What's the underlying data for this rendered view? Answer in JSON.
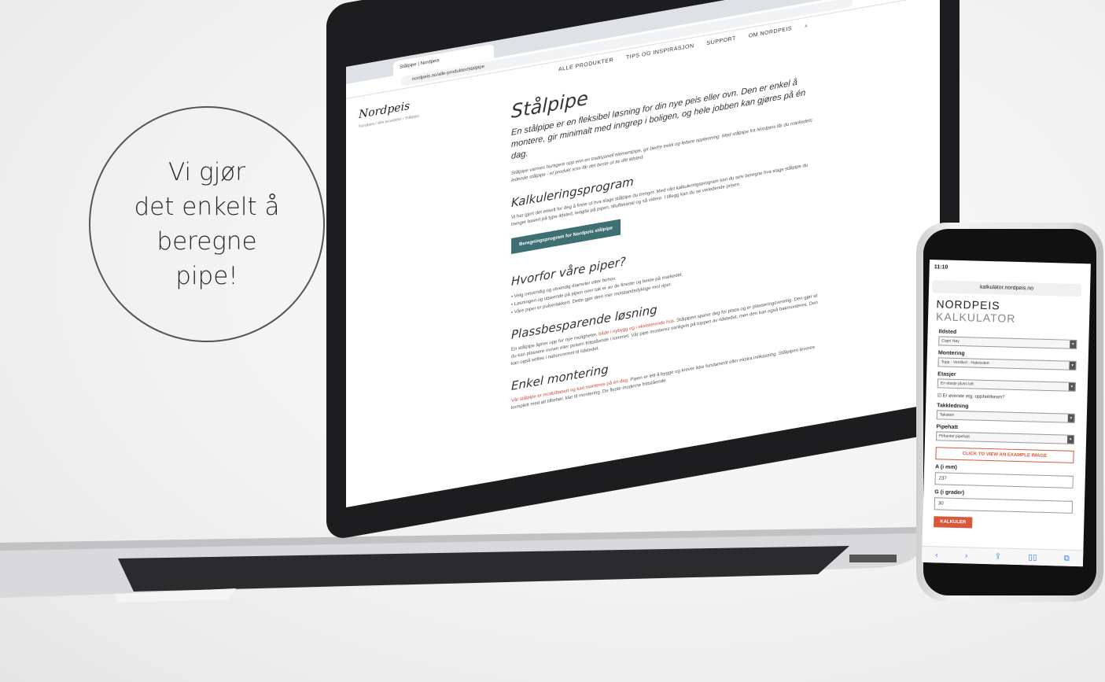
{
  "callout": {
    "text": "Vi gjør\ndet enkelt å\nberegne\npipe!"
  },
  "laptop": {
    "tab_title": "Stålpipe | Nordpeis",
    "url": "nordpeis.no/alle-produkter/stalpipe",
    "nav": [
      "ALLE PRODUKTER",
      "TIPS OG INSPIRASJON",
      "SUPPORT",
      "OM NORDPEIS"
    ],
    "logo": "Nordpeis",
    "breadcrumb": "Nordpeis / Alle produkter / Stålpipe",
    "title": "Stålpipe",
    "lead": "En stålpipe er en fleksibel løsning for din nye peis eller ovn. Den er enkel å montere, gir minimalt med inngrep i boligen, og hele jobben kan gjøres på én dag.",
    "intro_small": "Stålpipe varmes hurtigere opp enn en tradisjonell elementpipe, gir bedre trekk og lettere opptenning. Med stålpipe fra Nordpeis får du markedets ledende stålpipe - et produkt som får det beste ut av ditt ildsted.",
    "section1_title": "Kalkuleringsprogram",
    "section1_body": "Vi har gjort det enkelt for deg å finne ut hva slags stålpipe du trenger. Med vårt kalkuleringsprogram kan du selv beregne hva slags stålpipe du trenger basert på type ildsted, lengde på pipen, tilluftskanal og så videre. I tillegg kan du se veiledende prisen.",
    "cta_label": "Beregningsprogram for Nordpeis stålpipe",
    "section2_title": "Hvorfor våre piper?",
    "bullets": [
      "• Velg innvendig og utvendig diameter etter behov.",
      "• Løsningen og utseende på pipen over tak er av de fineste og beste på markedet.",
      "• Våre piper er pulverlakkert. Dette gjør dem mer motstandsdyktige mot riper."
    ],
    "section3_title": "Plassbesparende løsning",
    "section3_body_a": "En stålpipe åpner opp for nye muligheter, ",
    "section3_link": "både i nybygg og i eksisterende hus",
    "section3_body_b": ". Stålpipen sparer deg for plass og er plasseringsvennlig. Den gjør at du kan plassere ovnen eller peisen frittstående i rommet. Vår pipe monteres vanligvis på toppen av ildstedet, men den kan også bakmonteres. Den kan også settes i naborommet til ildstedet.",
    "section4_title": "Enkel montering",
    "section4_link": "Vår stålpipe er modulbasert og kan monteres på én dag",
    "section4_body": ". Pipen er lett å bygge og krever ikke fundament eller ekstra innkassing. Stålpipen leveres komplett med alt tilbehør, klar til montering. De fleste moderne frittstående"
  },
  "phone": {
    "time": "11:10",
    "address": "kalkulator.nordpeis.no",
    "brand_line1": "NORDPEIS",
    "brand_line2": "KALKULATOR",
    "ildsted_label": "Ildsted",
    "ildsted_value": "Capri Høy",
    "montering_label": "Montering",
    "montering_value": "Topp - Ventilert - Halvisolert",
    "etasjer_label": "Etasjer",
    "etasjer_value": "En etasje pluss loft",
    "checkbox_label": "Er øverste etg. oppholdsrom?",
    "takkledning_label": "Takkledning",
    "takkledning_value": "Takstein",
    "pipehatt_label": "Pipehatt",
    "pipehatt_value": "Firkantet pipehatt",
    "example_button": "CLICK TO VIEW AN EXAMPLE IMAGE",
    "a_label": "A (i mm)",
    "a_value": "237",
    "g_label": "G (i grader)",
    "g_value": "30",
    "submit_label": "KALKULER"
  }
}
